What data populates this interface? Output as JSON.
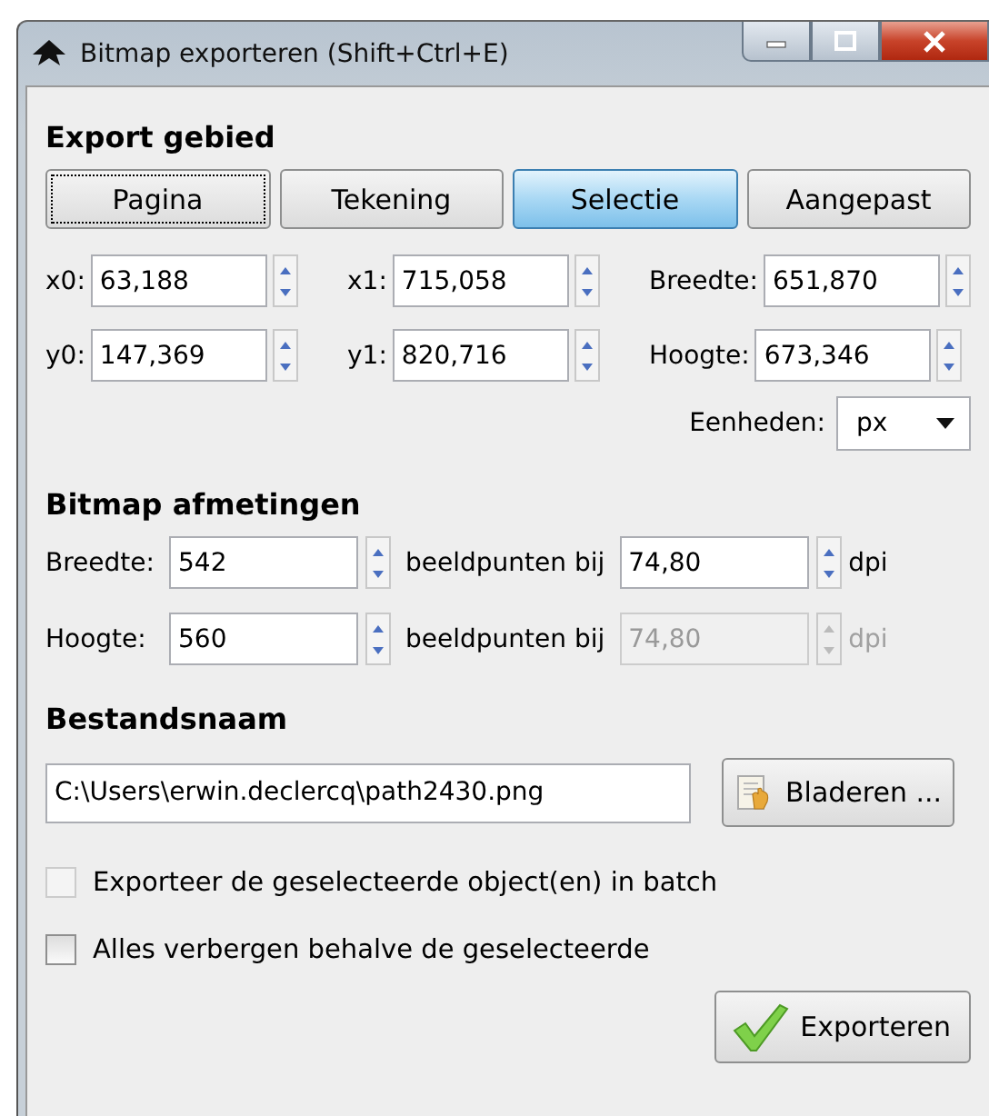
{
  "window": {
    "title": "Bitmap exporteren  (Shift+Ctrl+E)"
  },
  "export_area": {
    "heading": "Export gebied",
    "buttons": [
      {
        "label": "Pagina",
        "selected": false,
        "focused": true
      },
      {
        "label": "Tekening",
        "selected": false,
        "focused": false
      },
      {
        "label": "Selectie",
        "selected": true,
        "focused": false
      },
      {
        "label": "Aangepast",
        "selected": false,
        "focused": false
      }
    ],
    "coordinates": [
      {
        "label": "x0:",
        "value": "63,188"
      },
      {
        "label": "x1:",
        "value": "715,058"
      },
      {
        "label": "Breedte:",
        "value": "651,870"
      },
      {
        "label": "y0:",
        "value": "147,369"
      },
      {
        "label": "y1:",
        "value": "820,716"
      },
      {
        "label": "Hoogte:",
        "value": "673,346"
      }
    ],
    "units": {
      "label": "Eenheden:",
      "value": "px"
    }
  },
  "bitmap_size": {
    "heading": "Bitmap afmetingen",
    "rows": [
      {
        "label": "Breedte:",
        "value": "542",
        "connector": "beeldpunten bij",
        "dpi": "74,80",
        "dpi_unit": "dpi",
        "dpi_disabled": false
      },
      {
        "label": "Hoogte:",
        "value": "560",
        "connector": "beeldpunten bij",
        "dpi": "74,80",
        "dpi_unit": "dpi",
        "dpi_disabled": true
      }
    ]
  },
  "filename": {
    "heading": "Bestandsnaam",
    "value": "C:\\Users\\erwin.declercq\\path2430.png",
    "browse_button": "Bladeren ..."
  },
  "options": [
    {
      "label": "Exporteer de geselecteerde object(en) in batch",
      "checked": false,
      "disabled": true
    },
    {
      "label": "Alles verbergen behalve de geselecteerde",
      "checked": false,
      "disabled": false
    }
  ],
  "export_button": "Exporteren"
}
